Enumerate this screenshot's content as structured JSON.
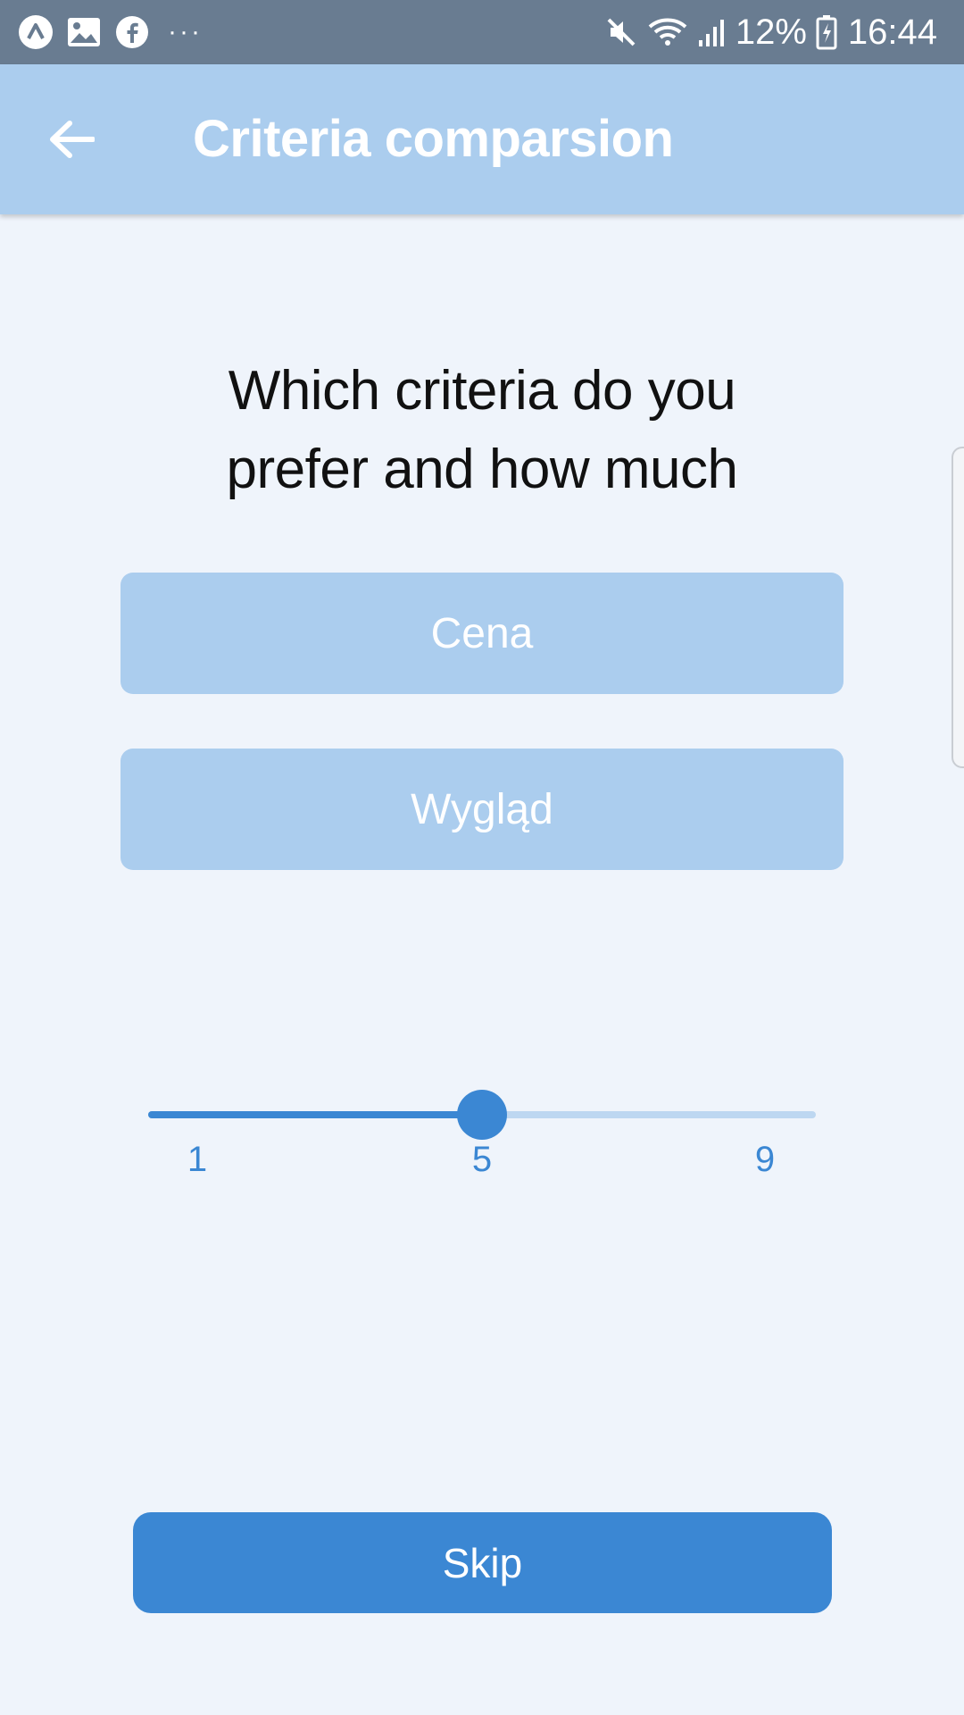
{
  "status_bar": {
    "battery": "12%",
    "time": "16:44",
    "left_icons": [
      "app-a-icon",
      "gallery-icon",
      "facebook-icon"
    ],
    "right_icons": [
      "mute-icon",
      "wifi-icon",
      "signal-icon",
      "battery-icon"
    ],
    "more": "···"
  },
  "app_bar": {
    "title": "Criteria comparsion",
    "back_icon": "arrow-left-icon"
  },
  "question": {
    "line1": "Which criteria do you",
    "line2": "prefer and how much"
  },
  "criteria": [
    "Cena",
    "Wygląd"
  ],
  "slider": {
    "min": 1,
    "max": 9,
    "value": 5,
    "ticks": [
      "1",
      "5",
      "9"
    ]
  },
  "skip_label": "Skip",
  "colors": {
    "accent": "#3b87d3",
    "accent_light": "#abcdee",
    "status_bar": "#697c91",
    "background": "#eff4fb"
  }
}
